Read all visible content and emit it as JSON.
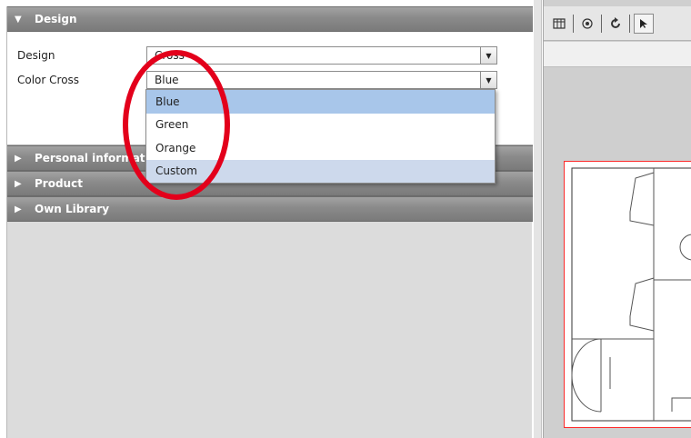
{
  "left_panel": {
    "sections": [
      {
        "label": "Design",
        "expanded": true
      },
      {
        "label": "Personal information",
        "expanded": false
      },
      {
        "label": "Product",
        "expanded": false
      },
      {
        "label": "Own Library",
        "expanded": false
      }
    ],
    "design": {
      "design_label": "Design",
      "design_value": "Cross",
      "color_label": "Color Cross",
      "color_value": "Blue"
    },
    "dropdown": {
      "options": [
        "Blue",
        "Green",
        "Orange",
        "Custom"
      ],
      "selected": "Blue",
      "hovered": "Custom"
    }
  },
  "toolbar": {
    "tools": [
      "grid-icon",
      "target-icon",
      "rotate-icon",
      "pointer-icon"
    ]
  },
  "colors": {
    "header_gray": "#8a8a8a",
    "selected_blue": "#a8c6ea",
    "highlight_red": "#e3001b",
    "canvas_border_red": "#ff2a2a"
  }
}
